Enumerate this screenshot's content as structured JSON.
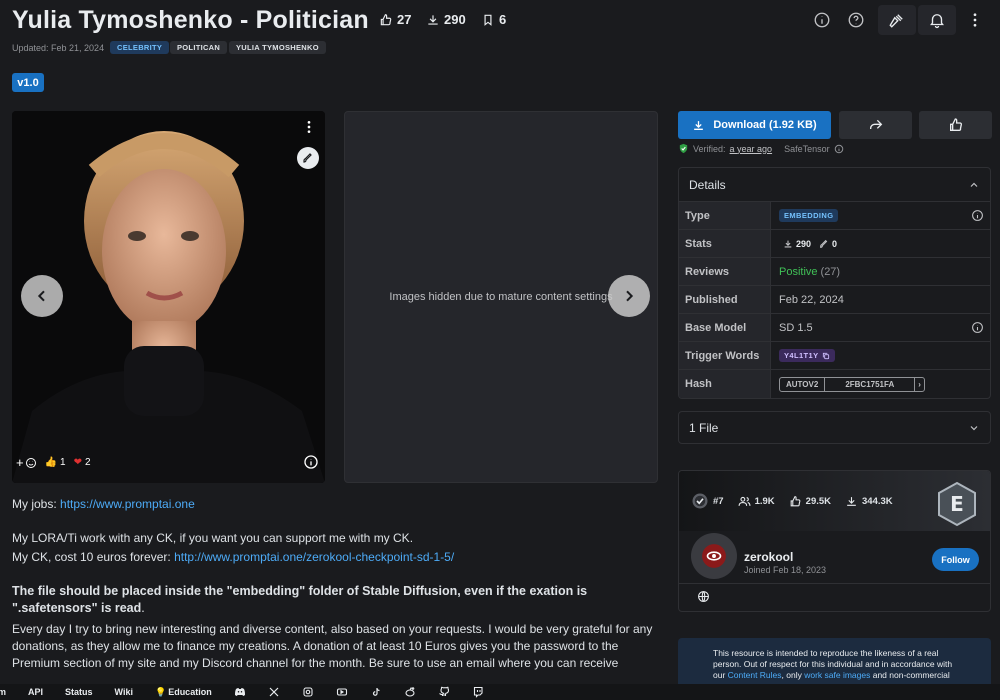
{
  "header": {
    "title": "Yulia Tymoshenko - Politician",
    "likes": "27",
    "downloads": "290",
    "bookmarks": "6",
    "updated": "Updated: Feb 21, 2024",
    "tags": [
      "CELEBRITY",
      "POLITICAN",
      "YULIA TYMOSHENKO"
    ],
    "version": "v1.0"
  },
  "gallery": {
    "hidden_text": "Images hidden due to mature content settings",
    "reactions": {
      "thumbs": "1",
      "heart": "2"
    }
  },
  "description": {
    "jobs_label": "My jobs: ",
    "jobs_link": "https://www.promptai.one",
    "line2": "My LORA/Ti work with any CK, if you want you can support me with my CK.",
    "line3_label": "My CK, cost 10 euros forever: ",
    "line3_link": "http://www.promptai.one/zerokool-checkpoint-sd-1-5/",
    "bold_line": "The file should be placed inside the \"embedding\" folder of Stable Diffusion, even if the exation is \".safetensors\" is read",
    "bold_tail": ".",
    "para": "Every day I try to bring new interesting and diverse content, also based on your requests. I would be very grateful for any donations, as they allow me to finance my creations. A donation of at least 10 Euros gives you the password to the Premium section of my site and my Discord channel for the month. Be sure to use an email where you can receive"
  },
  "actions": {
    "download_label": "Download (1.92 KB)",
    "verified_label": "Verified:",
    "verified_time": "a year ago",
    "format": "SafeTensor"
  },
  "details": {
    "heading": "Details",
    "rows": {
      "type_k": "Type",
      "type_v": "EMBEDDING",
      "stats_k": "Stats",
      "stats_dl": "290",
      "stats_gen": "0",
      "reviews_k": "Reviews",
      "reviews_v": "Positive",
      "reviews_n": "(27)",
      "published_k": "Published",
      "published_v": "Feb 22, 2024",
      "base_k": "Base Model",
      "base_v": "SD 1.5",
      "trigger_k": "Trigger Words",
      "trigger_v": "Y4L1T1Y",
      "hash_k": "Hash",
      "hash_type": "AUTOV2",
      "hash_v": "2FBC1751FA"
    }
  },
  "files": {
    "label": "1 File"
  },
  "creator": {
    "rank": "#7",
    "followers": "1.9K",
    "likes": "29.5K",
    "downloads": "344.3K",
    "name": "zerokool",
    "joined": "Joined Feb 18, 2023",
    "follow_label": "Follow"
  },
  "notice": {
    "text_a": "This resource is intended to reproduce the likeness of a real person. Out of respect for this individual and in accordance with our ",
    "link_a": "Content Rules",
    "text_b": ", only ",
    "link_b": "work safe images",
    "text_c": " and non-commercial"
  },
  "footer": [
    "m",
    "API",
    "Status",
    "Wiki",
    "Education"
  ],
  "colors": {
    "accent": "#1971c2",
    "bg": "#1a1b1e",
    "positive": "#40c057"
  }
}
